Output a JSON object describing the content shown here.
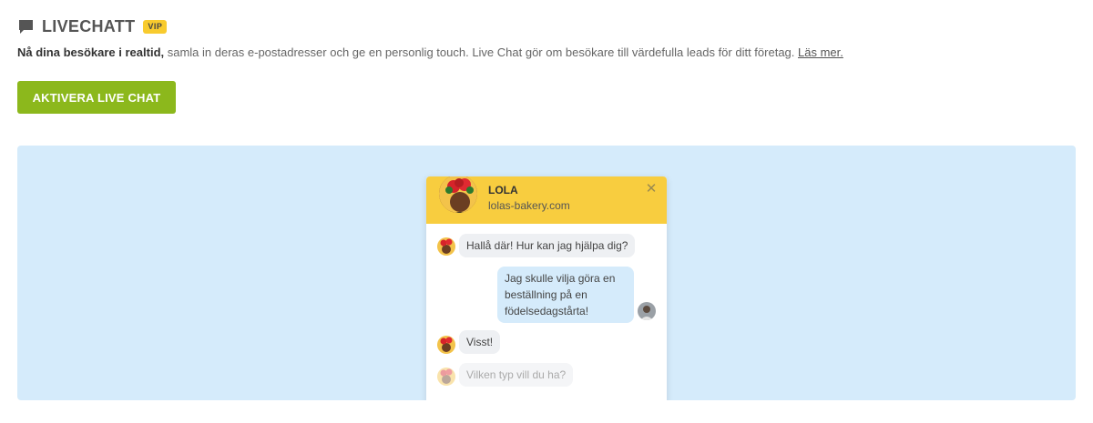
{
  "header": {
    "title": "LIVECHATT",
    "badge": "VIP"
  },
  "description": {
    "bold": "Nå dina besökare i realtid,",
    "text": " samla in deras e-postadresser och ge en personlig touch. Live Chat gör om besökare till värdefulla leads för ditt företag. ",
    "link": "Läs mer."
  },
  "activate_button": {
    "label": "AKTIVERA LIVE CHAT"
  },
  "widget": {
    "agent_name": "LOLA",
    "agent_site": "lolas-bakery.com",
    "messages": [
      {
        "from": "agent",
        "text": "Hallå där! Hur kan jag hjälpa dig?"
      },
      {
        "from": "user",
        "text": "Jag skulle vilja göra en beställning på en födelsedagstårta!"
      },
      {
        "from": "agent",
        "text": "Visst!"
      },
      {
        "from": "agent-typing",
        "text": "Vilken typ vill du ha?"
      }
    ]
  },
  "colors": {
    "accent_green": "#8cb81c",
    "widget_yellow": "#f8cd3f",
    "preview_bg": "#d5ebfb",
    "badge_yellow": "#f8cb2e"
  }
}
